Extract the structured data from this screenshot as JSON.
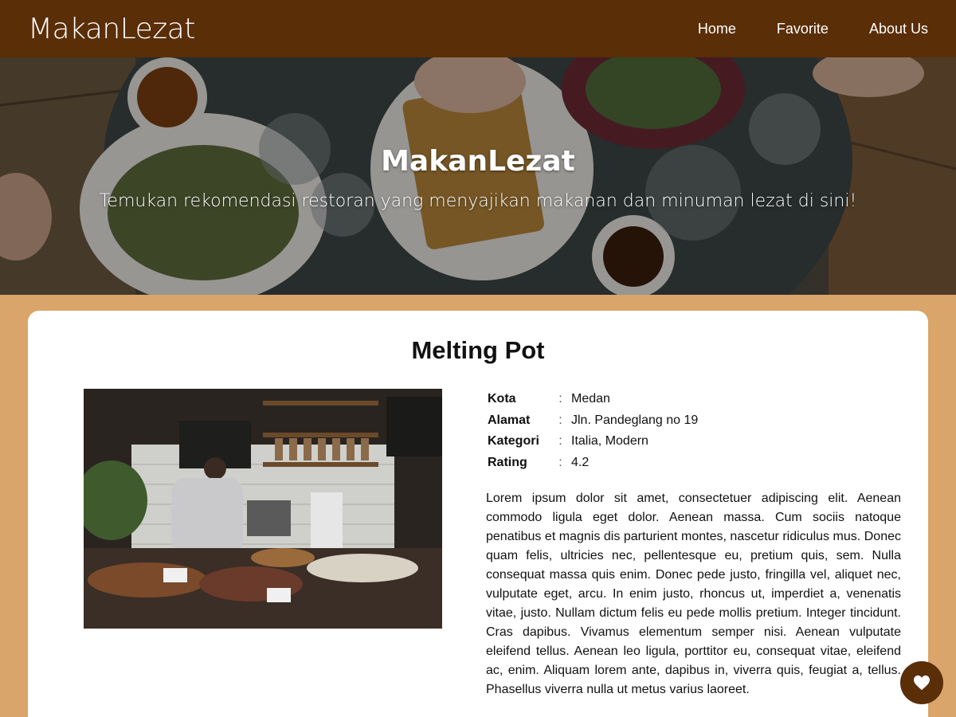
{
  "header": {
    "brand": "MakanLezat",
    "nav": [
      {
        "label": "Home"
      },
      {
        "label": "Favorite"
      },
      {
        "label": "About Us"
      }
    ]
  },
  "hero": {
    "title": "MakanLezat",
    "tagline": "Temukan rekomendasi restoran yang menyajikan makanan dan minuman lezat di sini!"
  },
  "restaurant": {
    "name": "Melting Pot",
    "info": [
      {
        "label": "Kota",
        "value": "Medan"
      },
      {
        "label": "Alamat",
        "value": "Jln. Pandeglang no 19"
      },
      {
        "label": "Kategori",
        "value": "Italia, Modern"
      },
      {
        "label": "Rating",
        "value": "4.2"
      }
    ],
    "separator": ":",
    "description": "Lorem ipsum dolor sit amet, consectetuer adipiscing elit. Aenean commodo ligula eget dolor. Aenean massa. Cum sociis natoque penatibus et magnis dis parturient montes, nascetur ridiculus mus. Donec quam felis, ultricies nec, pellentesque eu, pretium quis, sem. Nulla consequat massa quis enim. Donec pede justo, fringilla vel, aliquet nec, vulputate eget, arcu. In enim justo, rhoncus ut, imperdiet a, venenatis vitae, justo. Nullam dictum felis eu pede mollis pretium. Integer tincidunt. Cras dapibus. Vivamus elementum semper nisi. Aenean vulputate eleifend tellus. Aenean leo ligula, porttitor eu, consequat vitae, eleifend ac, enim. Aliquam lorem ante, dapibus in, viverra quis, feugiat a, tellus. Phasellus viverra nulla ut metus varius laoreet."
  },
  "favorite_button": {
    "icon": "heart-icon"
  },
  "colors": {
    "header_bg": "#5a2e07",
    "page_bg": "#d9a56b",
    "card_bg": "#ffffff",
    "fab_bg": "#5a2e07"
  }
}
